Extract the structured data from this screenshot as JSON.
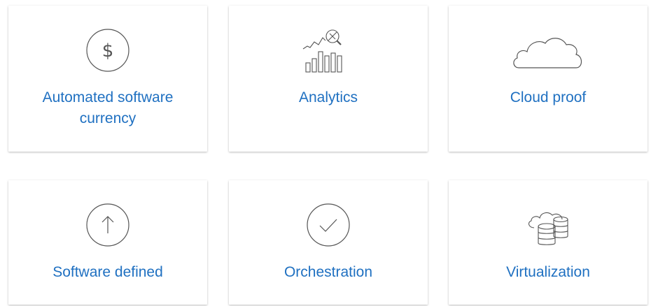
{
  "accent_color": "#1f70c1",
  "icon_color": "#555555",
  "cards": [
    {
      "label": "Automated software currency",
      "icon": "dollar-circle-icon"
    },
    {
      "label": "Analytics",
      "icon": "analytics-chart-icon"
    },
    {
      "label": "Cloud proof",
      "icon": "cloud-icon"
    },
    {
      "label": "Software defined",
      "icon": "arrow-up-circle-icon"
    },
    {
      "label": "Orchestration",
      "icon": "checkmark-circle-icon"
    },
    {
      "label": "Virtualization",
      "icon": "cloud-database-icon"
    }
  ]
}
